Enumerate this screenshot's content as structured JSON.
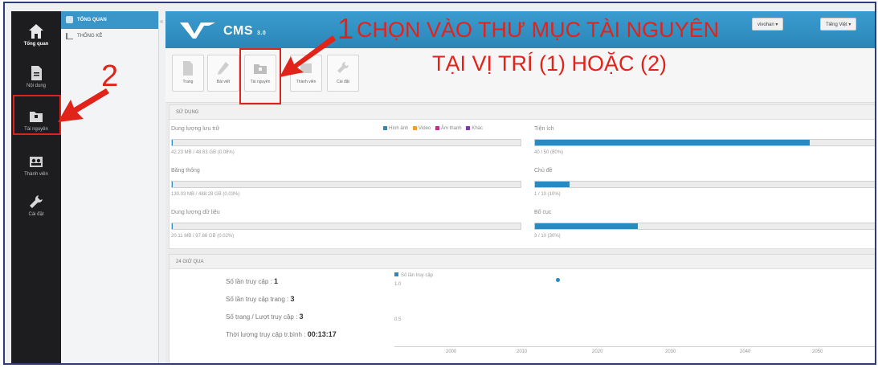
{
  "rail": {
    "items": [
      {
        "label": "Tổng quan",
        "icon": "home-icon"
      },
      {
        "label": "Nội dung",
        "icon": "document-icon"
      },
      {
        "label": "Tài nguyên",
        "icon": "folder-icon"
      },
      {
        "label": "Thành viên",
        "icon": "users-icon"
      },
      {
        "label": "Cài đặt",
        "icon": "wrench-icon"
      }
    ]
  },
  "sidebar": {
    "header": "TỔNG QUAN",
    "items": [
      {
        "label": "THỐNG KÊ"
      }
    ]
  },
  "topbar": {
    "logo_brand": "vnvn",
    "logo_text": "CMS",
    "logo_version": "3.0",
    "user_dropdown": "vivohan ▾",
    "language_dropdown": "Tiếng Việt ▾",
    "accent": "#2c86b8"
  },
  "toolbar": {
    "items": [
      {
        "label": "Trang",
        "icon": "page-icon"
      },
      {
        "label": "Bài viết",
        "icon": "pencil-icon"
      },
      {
        "label": "Tài nguyên",
        "icon": "folder-icon"
      },
      {
        "label": "Thành viên",
        "icon": "users-icon"
      },
      {
        "label": "Cài đặt",
        "icon": "wrench-icon"
      }
    ]
  },
  "usage": {
    "title": "SỬ DỤNG",
    "legend": [
      "Hình ảnh",
      "Video",
      "Âm thanh",
      "Khác"
    ],
    "left": [
      {
        "label": "Dung lượng lưu trữ",
        "value": "42.23 MB / 48.83 GB (0.08%)",
        "fraction": 0.0008
      },
      {
        "label": "Băng thông",
        "value": "130.03 MB / 488.28 GB (0.03%)",
        "fraction": 0.0003
      },
      {
        "label": "Dung lượng dữ liệu",
        "value": "20.11 MB / 97.66 GB (0.02%)",
        "fraction": 0.0002
      }
    ],
    "right": [
      {
        "label": "Tiện ích",
        "value": "40 / 50 (80%)",
        "fraction": 0.8
      },
      {
        "label": "Chủ đề",
        "value": "1 / 10 (10%)",
        "fraction": 0.1
      },
      {
        "label": "Bố cục",
        "value": "3 / 10 (30%)",
        "fraction": 0.3
      }
    ]
  },
  "last24": {
    "title": "24 GIỜ QUA",
    "stats": [
      {
        "label": "Số lần truy cập :",
        "value": "1"
      },
      {
        "label": "Số lần truy cập trang :",
        "value": "3"
      },
      {
        "label": "Số trang / Lượt truy cập :",
        "value": "3"
      },
      {
        "label": "Thời lượng truy cập tr.bình :",
        "value": "00:13:17"
      }
    ],
    "chart": {
      "legend": "Số lần truy cập",
      "y_ticks": [
        "1.0",
        "0.5"
      ],
      "x_ticks": [
        "2000",
        "2010",
        "2020",
        "2030",
        "2040",
        "2050"
      ]
    }
  },
  "annotations": {
    "step1_number": "1",
    "step1_line1": "CHỌN VÀO THƯ MỤC TÀI NGUYÊN",
    "step1_line2": "TẠI VỊ TRÍ (1) HOẶC (2)",
    "step2_number": "2",
    "color": "#e2231a"
  }
}
